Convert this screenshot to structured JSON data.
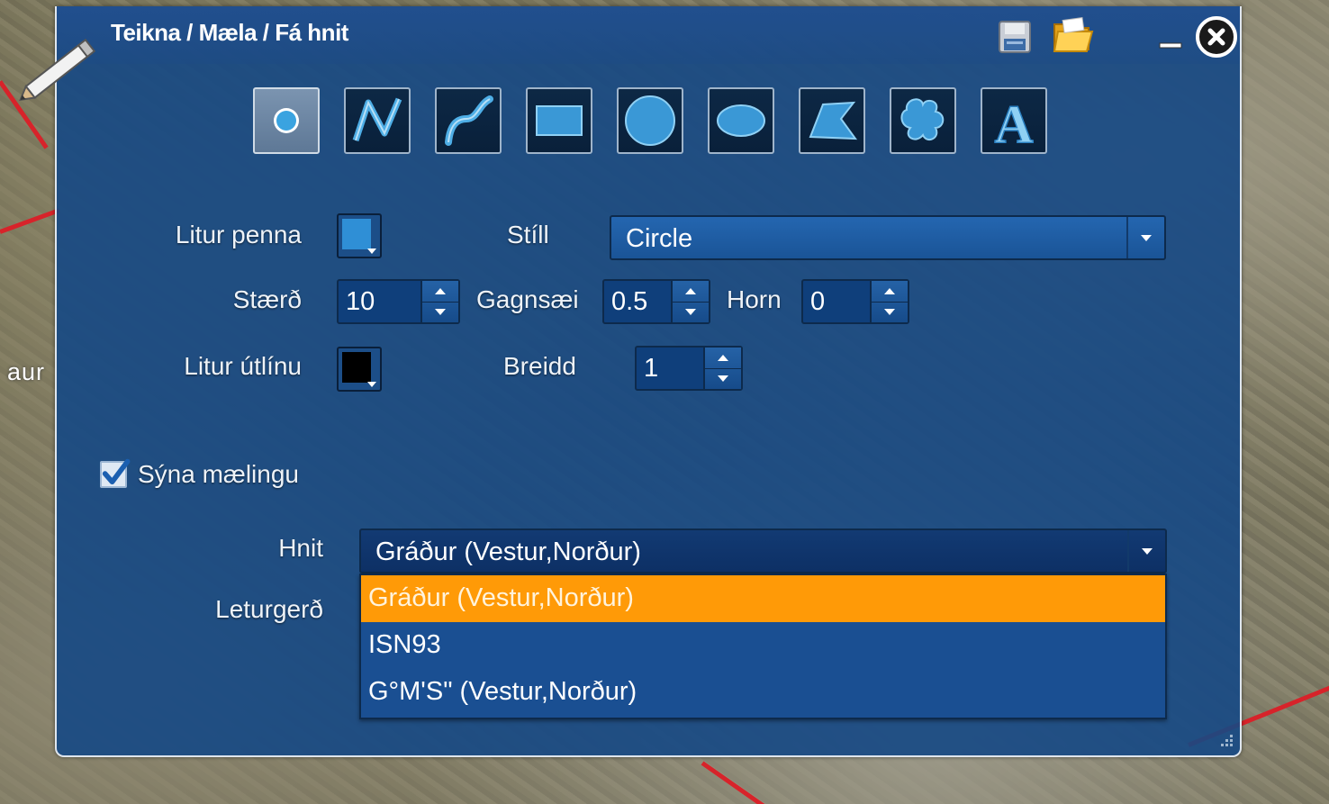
{
  "map": {
    "label": "aur"
  },
  "dialog": {
    "title": "Teikna / Mæla / Fá hnit",
    "tools": [
      {
        "name": "point-tool",
        "icon": "point-icon",
        "active": true
      },
      {
        "name": "polyline-tool",
        "icon": "polyline-icon",
        "active": false
      },
      {
        "name": "freehand-line-tool",
        "icon": "freehand-line-icon",
        "active": false
      },
      {
        "name": "rectangle-tool",
        "icon": "rectangle-icon",
        "active": false
      },
      {
        "name": "circle-tool",
        "icon": "circle-icon",
        "active": false
      },
      {
        "name": "ellipse-tool",
        "icon": "ellipse-icon",
        "active": false
      },
      {
        "name": "polygon-tool",
        "icon": "polygon-icon",
        "active": false
      },
      {
        "name": "freehand-polygon-tool",
        "icon": "freehand-polygon-icon",
        "active": false
      },
      {
        "name": "text-tool",
        "icon": "text-icon",
        "active": false
      }
    ],
    "text_tool_glyph": "A",
    "form": {
      "pen_color_label": "Litur penna",
      "pen_color": "#2f8fd6",
      "style_label": "Stíll",
      "style_value": "Circle",
      "size_label": "Stærð",
      "size_value": "10",
      "opacity_label": "Gagnsæi",
      "opacity_value": "0.5",
      "angle_label": "Horn",
      "angle_value": "0",
      "outline_color_label": "Litur útlínu",
      "outline_color": "#000000",
      "width_label": "Breidd",
      "width_value": "1",
      "show_measurement_label": "Sýna mælingu",
      "show_measurement_checked": true,
      "coords_label": "Hnit",
      "coords_value": "Gráður (Vestur,Norður)",
      "font_label": "Leturgerð"
    },
    "coords_options": [
      {
        "label": "Gráður (Vestur,Norður)",
        "selected": true
      },
      {
        "label": "ISN93",
        "selected": false
      },
      {
        "label": "G°M'S\" (Vestur,Norður)",
        "selected": false
      }
    ],
    "colors": {
      "highlight": "#ff9a07",
      "panel": "#164884"
    }
  }
}
